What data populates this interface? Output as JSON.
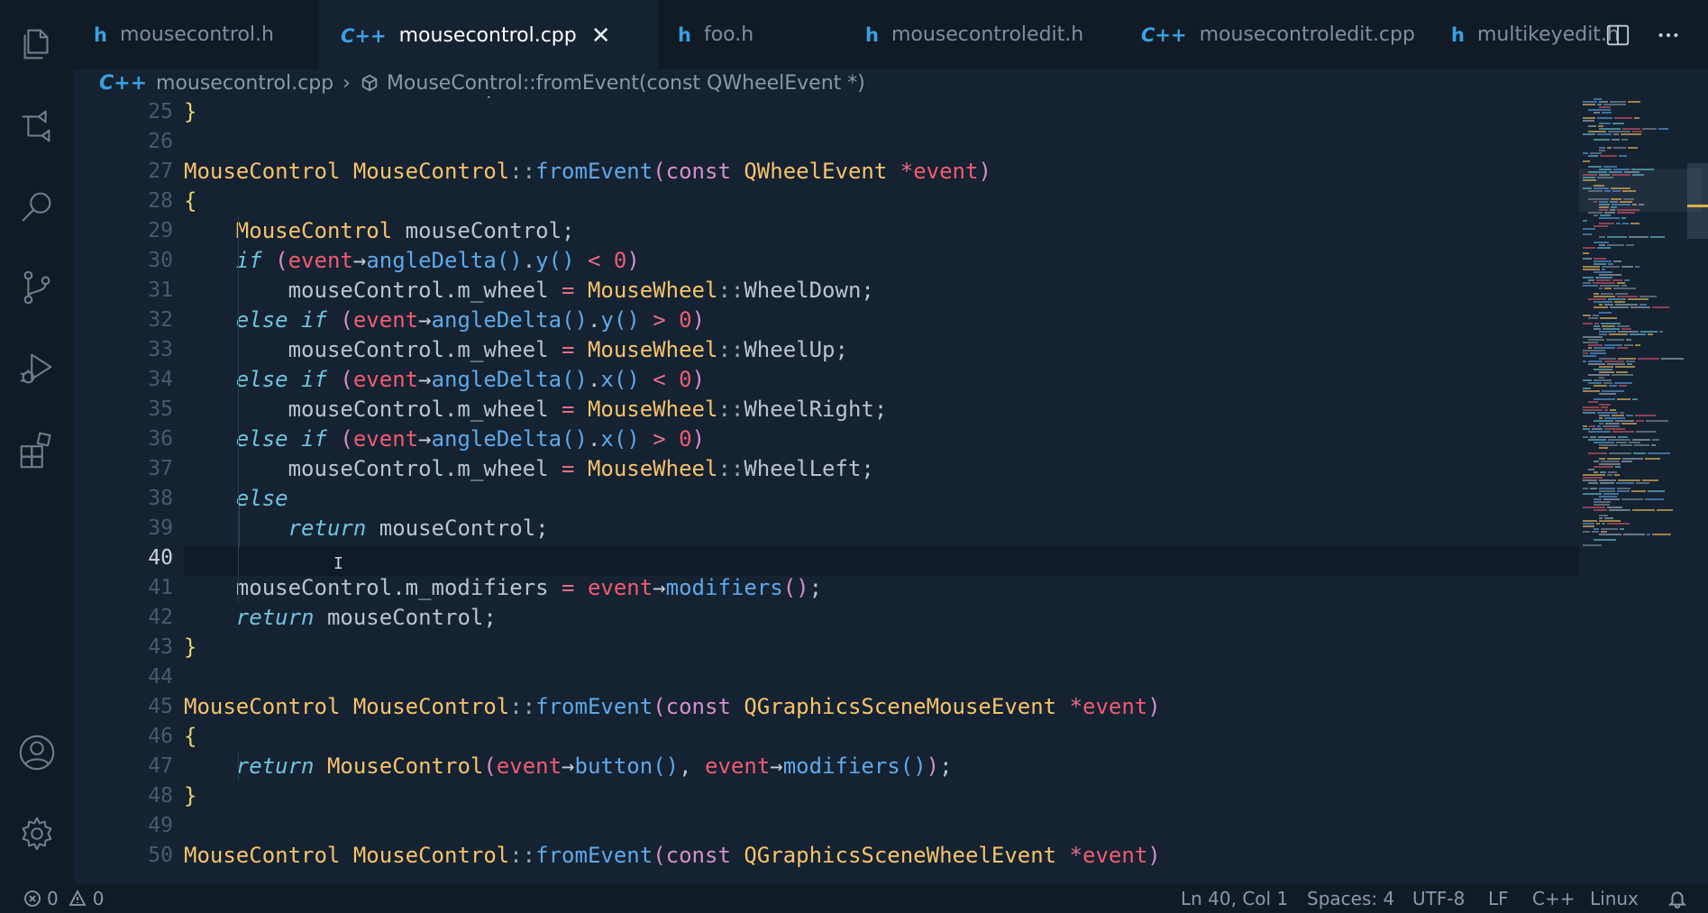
{
  "activity": {
    "items": [
      "explorer-icon",
      "ci-icon",
      "search-icon",
      "source-control-icon",
      "run-debug-icon",
      "extensions-icon"
    ],
    "bottom": [
      "account-icon",
      "settings-gear-icon"
    ]
  },
  "tabs": [
    {
      "icon": "h",
      "label": "mousecontrol.h",
      "active": false
    },
    {
      "icon": "C++",
      "label": "mousecontrol.cpp",
      "active": true
    },
    {
      "icon": "h",
      "label": "foo.h",
      "active": false
    },
    {
      "icon": "h",
      "label": "mousecontroledit.h",
      "active": false
    },
    {
      "icon": "C++",
      "label": "mousecontroledit.cpp",
      "active": false
    },
    {
      "icon": "h",
      "label": "multikeyedit.h",
      "active": false
    }
  ],
  "tab_close_glyph": "✕",
  "breadcrumb": {
    "file_icon": "C++",
    "file": "mousecontrol.cpp",
    "separator": "›",
    "symbol": "MouseControl::fromEvent(const QWheelEvent *)"
  },
  "editor": {
    "line_numbers": [
      "25",
      "26",
      "27",
      "28",
      "29",
      "30",
      "31",
      "32",
      "33",
      "34",
      "35",
      "36",
      "37",
      "38",
      "39",
      "40",
      "41",
      "42",
      "43",
      "44",
      "45",
      "46",
      "47",
      "48",
      "49",
      "50"
    ],
    "current_line": "40"
  },
  "status": {
    "errors": "0",
    "warnings": "0",
    "position": "Ln 40, Col 1",
    "spaces": "Spaces: 4",
    "encoding": "UTF-8",
    "eol": "LF",
    "language": "C++",
    "os": "Linux"
  },
  "colors": {
    "background": "#152231",
    "type": "#f6c36b",
    "function": "#5ea9e8",
    "keyword": "#6fc3dc",
    "param": "#ef5b72"
  }
}
